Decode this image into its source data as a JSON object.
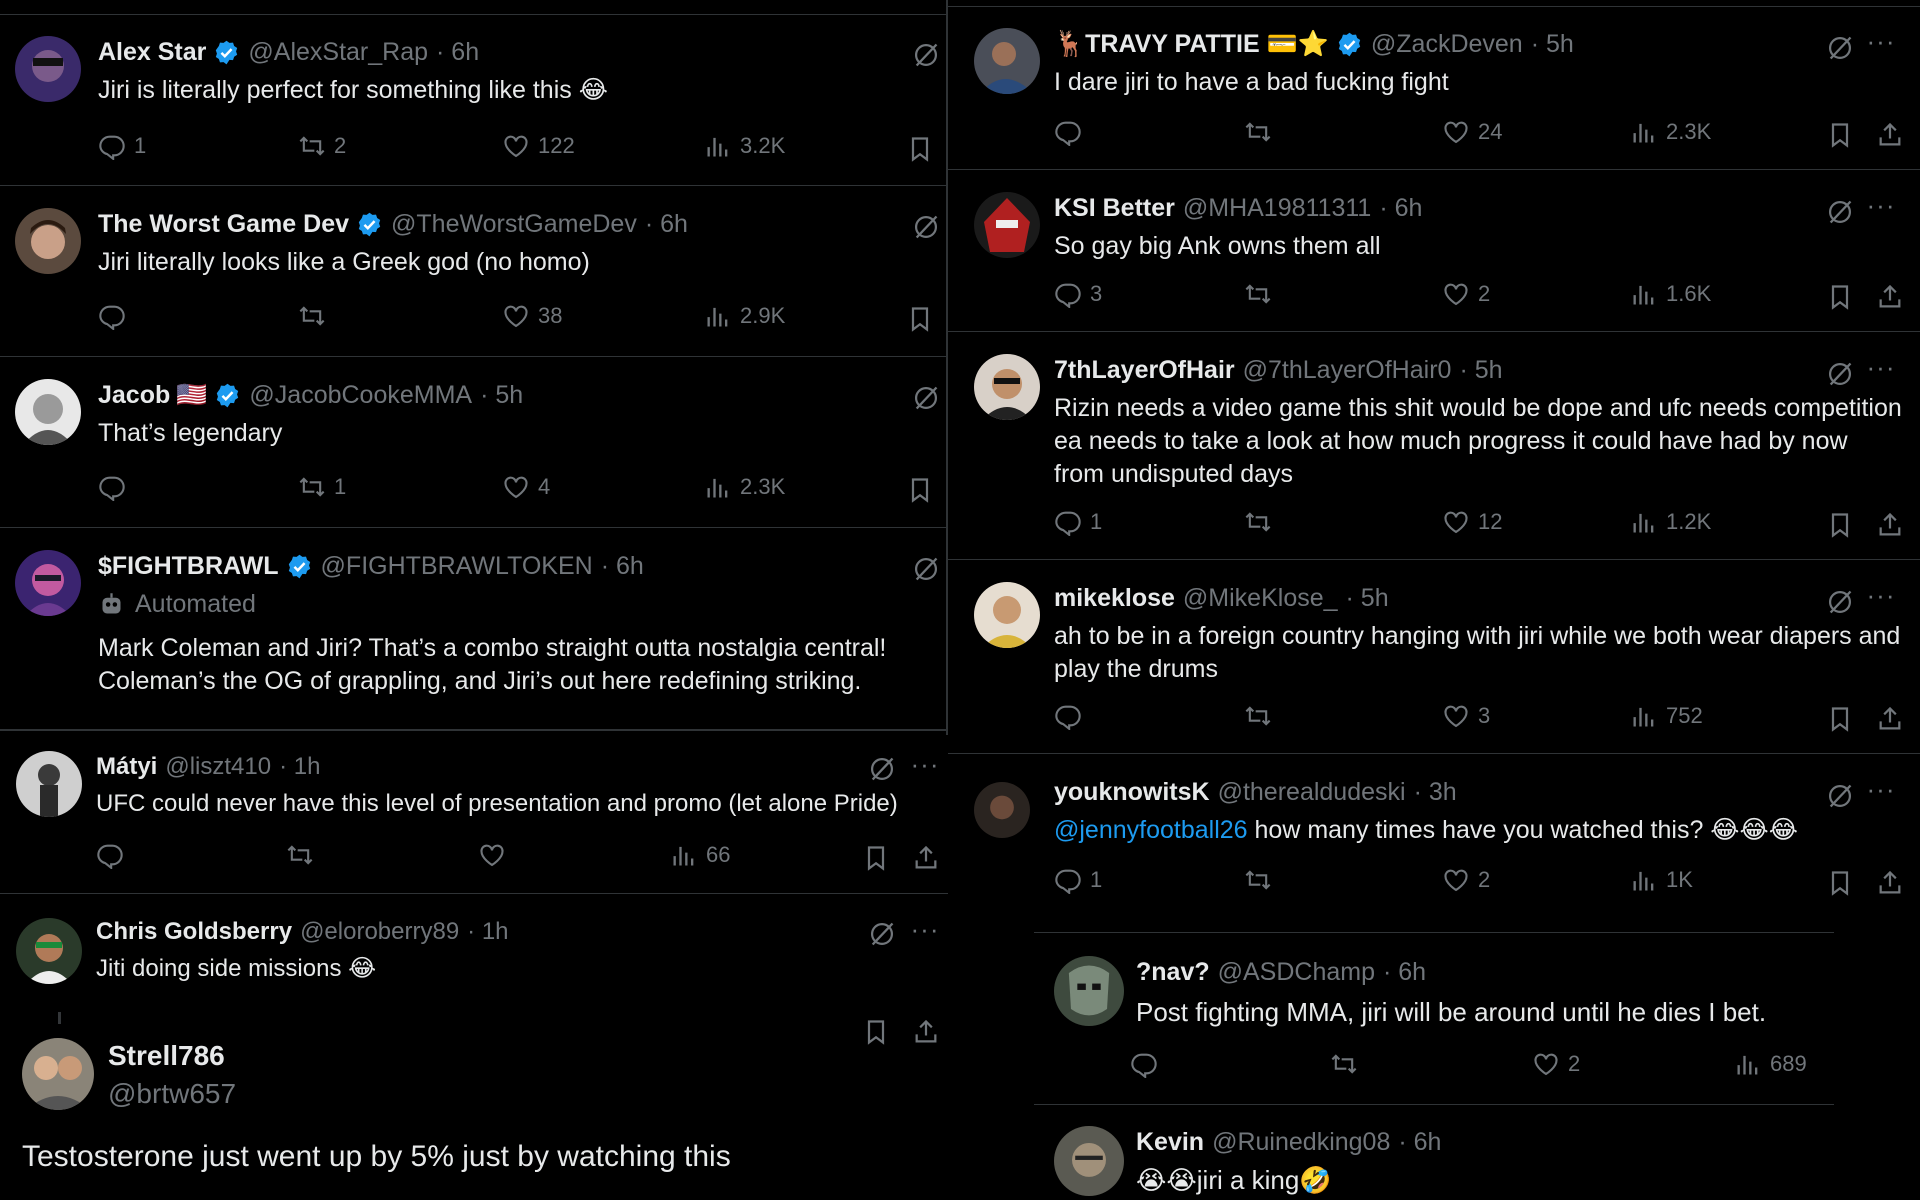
{
  "left": {
    "tweets": [
      {
        "name": "Alex Star",
        "verified": true,
        "handle": "@AlexStar_Rap",
        "time": "· 6h",
        "text": "Jiri is literally perfect for something like this 😂",
        "replies": "1",
        "reposts": "2",
        "likes": "122",
        "views": "3.2K"
      },
      {
        "name": "The Worst Game Dev",
        "verified": true,
        "handle": "@TheWorstGameDev",
        "time": "· 6h",
        "text": "Jiri literally looks like a Greek god (no homo)",
        "replies": "",
        "reposts": "",
        "likes": "38",
        "views": "2.9K"
      },
      {
        "name": "Jacob",
        "flag": "🇺🇸",
        "verified": true,
        "handle": "@JacobCookeMMA",
        "time": "· 5h",
        "text": "That’s legendary",
        "replies": "",
        "reposts": "1",
        "likes": "4",
        "views": "2.3K"
      },
      {
        "name": "$FIGHTBRAWL",
        "verified": true,
        "handle": "@FIGHTBRAWLTOKEN",
        "time": "· 6h",
        "automated": "Automated",
        "text": "Mark Coleman and Jiri? That’s a combo straight outta nostalgia central! Coleman’s the OG of grappling, and Jiri’s out here redefining striking."
      },
      {
        "name": "Mátyi",
        "verified": false,
        "handle": "@liszt410",
        "time": "· 1h",
        "text": "UFC could never have this level of presentation and promo (let alone Pride)",
        "replies": "",
        "reposts": "",
        "likes": "",
        "views": "66"
      },
      {
        "name": "Chris Goldsberry",
        "verified": false,
        "handle": "@eloroberry89",
        "time": "· 1h",
        "text": "Jiti doing side missions 😂"
      }
    ],
    "big": {
      "name": "Strell786",
      "handle": "@brtw657",
      "text": "Testosterone just went up by 5% just by watching this"
    }
  },
  "right": {
    "tweets": [
      {
        "name": "🦌TRAVY PATTIE 💳⭐",
        "verified": true,
        "handle": "@ZackDeven",
        "time": "· 5h",
        "text": "I dare jiri to have a bad fucking fight",
        "replies": "",
        "reposts": "",
        "likes": "24",
        "views": "2.3K"
      },
      {
        "name": "KSI Better",
        "verified": false,
        "handle": "@MHA19811311",
        "time": "· 6h",
        "text": "So gay big Ank owns them all",
        "replies": "3",
        "reposts": "",
        "likes": "2",
        "views": "1.6K"
      },
      {
        "name": "7thLayerOfHair",
        "verified": false,
        "handle": "@7thLayerOfHair0",
        "time": "· 5h",
        "text": "Rizin needs a video game this shit would be dope and ufc needs competition ea needs to take a look at how much progress it could have had by now from undisputed days",
        "replies": "1",
        "reposts": "",
        "likes": "12",
        "views": "1.2K"
      },
      {
        "name": "mikeklose",
        "verified": false,
        "handle": "@MikeKlose_",
        "time": "· 5h",
        "text": "ah to be in a foreign country hanging with jiri while we both wear diapers and play the drums",
        "replies": "",
        "reposts": "",
        "likes": "3",
        "views": "752"
      },
      {
        "name": "youknowitsK",
        "verified": false,
        "handle": "@therealdudeski",
        "time": "· 3h",
        "mention": "@jennyfootball26",
        "text": " how many times have you watched this? 😂😂😂",
        "replies": "1",
        "reposts": "",
        "likes": "2",
        "views": "1K"
      },
      {
        "name": "?nav?",
        "verified": false,
        "handle": "@ASDChamp",
        "time": "· 6h",
        "text": "Post fighting MMA, jiri will be around until he dies I bet.",
        "replies": "",
        "reposts": "",
        "likes": "2",
        "views": "689"
      },
      {
        "name": "Kevin",
        "verified": false,
        "handle": "@Ruinedking08",
        "time": "· 6h",
        "text": "😭😭jiri a king🤣"
      }
    ]
  },
  "icons": {
    "reply": "reply-icon",
    "repost": "repost-icon",
    "like": "heart-icon",
    "views": "views-icon",
    "bookmark": "bookmark-icon",
    "share": "share-icon",
    "grok": "grok-icon",
    "more": "more-icon",
    "verified": "verified-badge-icon"
  },
  "colors": {
    "background": "#000000",
    "text": "#e7e9ea",
    "muted": "#71767b",
    "accent": "#1d9bf0",
    "border": "#2f3336"
  }
}
